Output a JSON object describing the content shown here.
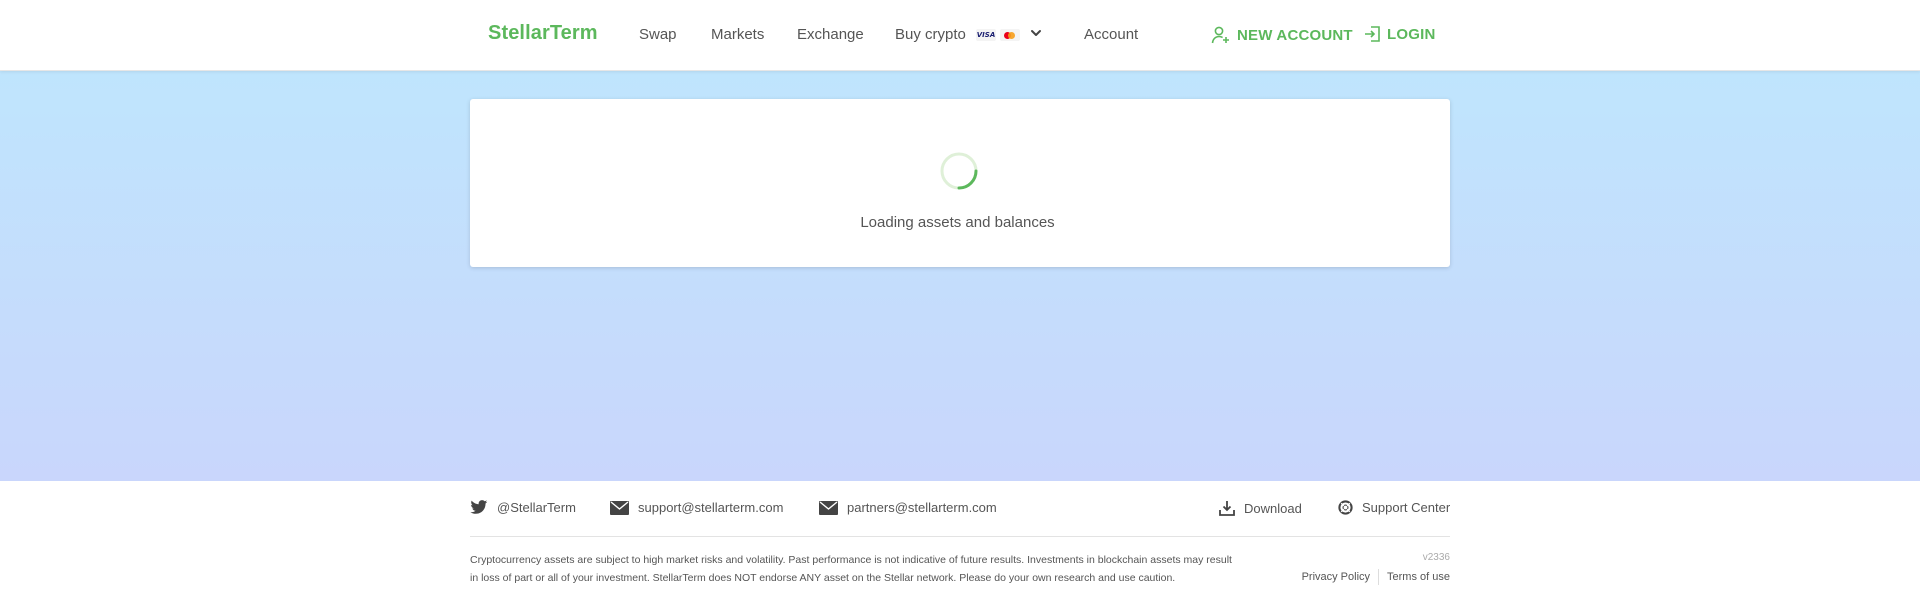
{
  "header": {
    "logo": "StellarTerm",
    "nav": {
      "swap": "Swap",
      "markets": "Markets",
      "exchange": "Exchange",
      "buy_crypto": "Buy crypto",
      "account": "Account"
    },
    "card_brands": [
      "visa-icon",
      "mastercard-icon"
    ],
    "visa_text": "VISA",
    "new_account": "NEW ACCOUNT",
    "login": "LOGIN",
    "accent_color": "#5cb85c"
  },
  "main": {
    "gradient_top": "#bfe5fd",
    "gradient_bottom": "#c9d6fc",
    "loading_text": "Loading assets and balances"
  },
  "footer": {
    "twitter": "@StellarTerm",
    "support_email": "support@stellarterm.com",
    "partners_email": "partners@stellarterm.com",
    "download": "Download",
    "support_center": "Support Center",
    "disclaimer": "Cryptocurrency assets are subject to high market risks and volatility. Past performance is not indicative of future results. Investments in blockchain assets may result in loss of part or all of your investment. StellarTerm does NOT endorse ANY asset on the Stellar network. Please do your own research and use caution.",
    "version": "v2336",
    "privacy_policy": "Privacy Policy",
    "terms_of_use": "Terms of use"
  }
}
